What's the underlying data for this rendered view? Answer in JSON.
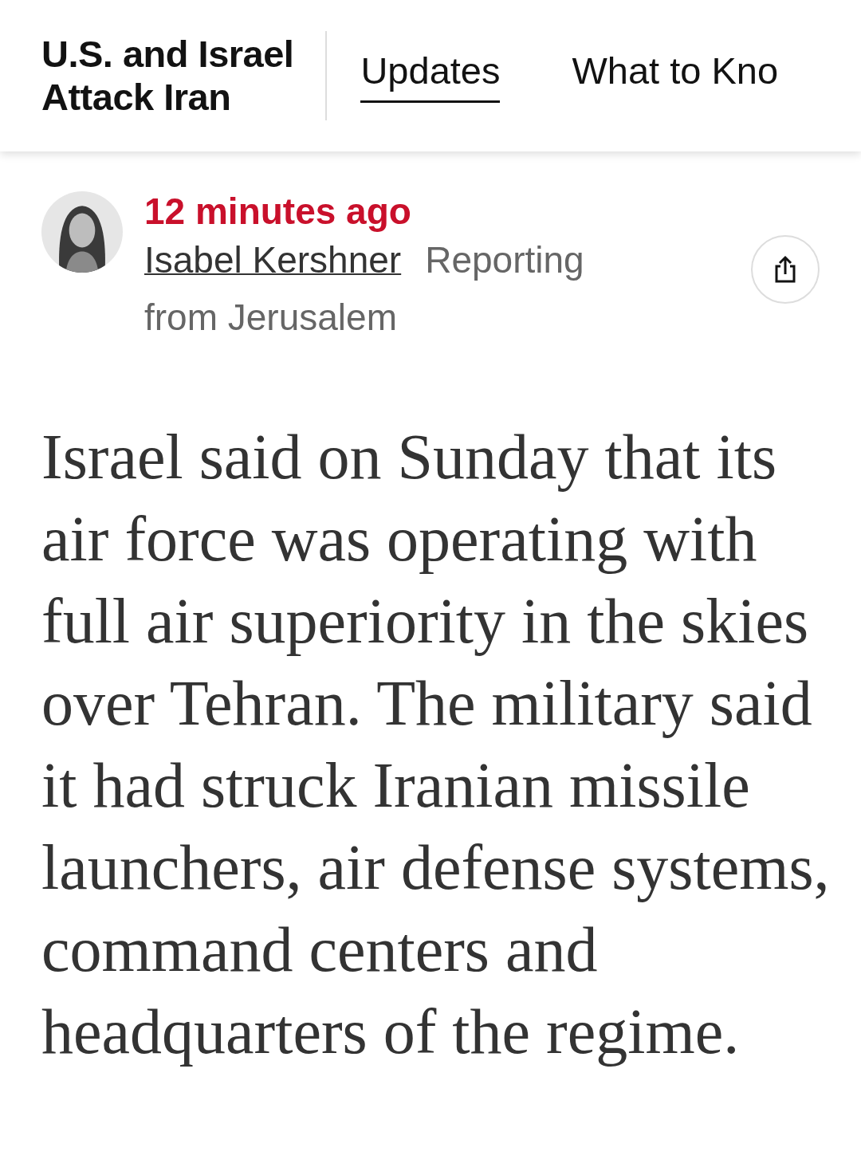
{
  "header": {
    "title_lines": [
      "U.S. and Israel",
      "Attack Iran"
    ],
    "tabs": [
      {
        "label": "Updates",
        "selected": true
      },
      {
        "label": "What to Kno",
        "selected": false
      }
    ]
  },
  "post": {
    "kind": "picture",
    "time": "12 minutes ago",
    "author": "Isabel Kershner",
    "dateline_lines": [
      "Reporting",
      "from Jerusalem"
    ],
    "body": "Israel said on Sunday that its air force was operating with full air superiority in the skies over Tehran. The military said it had struck Iranian missile launchers, air defense systems, command centers and headquarters of the regime."
  }
}
